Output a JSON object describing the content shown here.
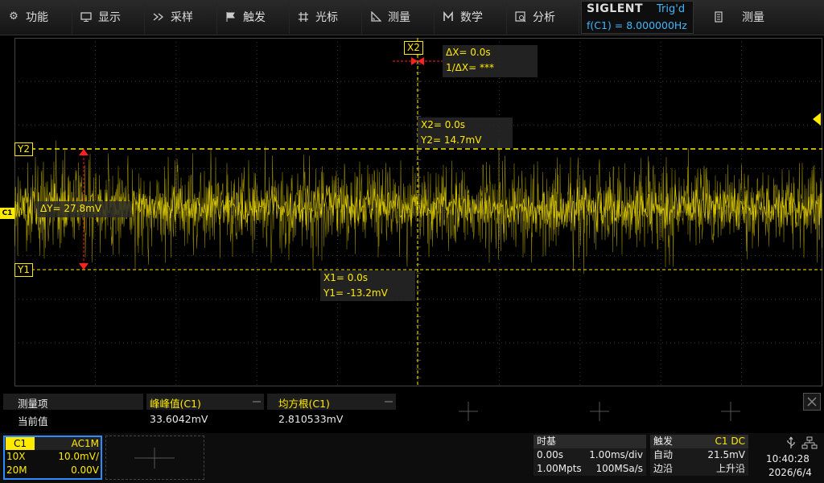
{
  "menu": {
    "items": [
      {
        "icon": "gear-icon",
        "label": "功能"
      },
      {
        "icon": "display-icon",
        "label": "显示"
      },
      {
        "icon": "sample-icon",
        "label": "采样"
      },
      {
        "icon": "flag-icon",
        "label": "触发"
      },
      {
        "icon": "crosshair-icon",
        "label": "光标"
      },
      {
        "icon": "ruler-icon",
        "label": "测量"
      },
      {
        "icon": "math-icon",
        "label": "数学"
      },
      {
        "icon": "analyze-icon",
        "label": "分析"
      }
    ],
    "brand": "SIGLENT",
    "trig_status": "Trig'd",
    "freq": "f(C1) = 8.000000Hz",
    "measure_label": "测量"
  },
  "cursors": {
    "x2_tag": "X2",
    "y2_tag": "Y2",
    "y1_tag": "Y1",
    "ch_tag": "C1",
    "dx": "ΔX= 0.0s",
    "inv_dx": "1/ΔX= ***",
    "x2_time": "X2= 0.0s",
    "y2_val": "Y2= 14.7mV",
    "dy": "ΔY= 27.8mV",
    "x1_time": "X1= 0.0s",
    "y1_val": "Y1= -13.2mV"
  },
  "measurements": {
    "col_item": "测量项",
    "col_peak": "峰峰值(C1)",
    "col_rms": "均方根(C1)",
    "row_label": "当前值",
    "peak_value": "33.6042mV",
    "rms_value": "2.810533mV"
  },
  "channel": {
    "name": "C1",
    "coupling": "AC1M",
    "probe": "10X",
    "scale": "10.0mV/",
    "bandwidth": "20M",
    "offset": "0.00V"
  },
  "timebase": {
    "title": "时基",
    "delay": "0.00s",
    "scale": "1.00ms/div",
    "depth": "1.00Mpts",
    "rate": "100MSa/s"
  },
  "trigger": {
    "title": "触发",
    "source": "C1 DC",
    "mode": "自动",
    "level": "21.5mV",
    "type": "边沿",
    "slope": "上升沿"
  },
  "status": {
    "time": "10:40:28",
    "date": "2026/6/4"
  },
  "colors": {
    "trace": "#ffea00",
    "cursor": "#ffea00",
    "marker": "#ff2020",
    "accent": "#2f8cff",
    "trig_text": "#3fb7ff"
  }
}
